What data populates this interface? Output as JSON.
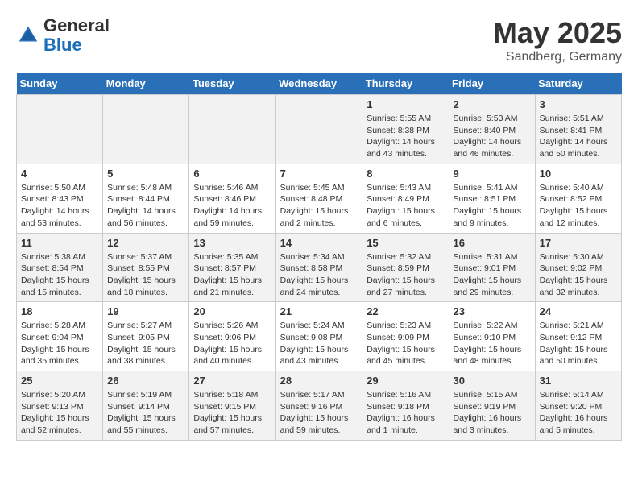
{
  "header": {
    "logo_general": "General",
    "logo_blue": "Blue",
    "month": "May 2025",
    "location": "Sandberg, Germany"
  },
  "days_of_week": [
    "Sunday",
    "Monday",
    "Tuesday",
    "Wednesday",
    "Thursday",
    "Friday",
    "Saturday"
  ],
  "weeks": [
    [
      {
        "day": "",
        "info": ""
      },
      {
        "day": "",
        "info": ""
      },
      {
        "day": "",
        "info": ""
      },
      {
        "day": "",
        "info": ""
      },
      {
        "day": "1",
        "info": "Sunrise: 5:55 AM\nSunset: 8:38 PM\nDaylight: 14 hours\nand 43 minutes."
      },
      {
        "day": "2",
        "info": "Sunrise: 5:53 AM\nSunset: 8:40 PM\nDaylight: 14 hours\nand 46 minutes."
      },
      {
        "day": "3",
        "info": "Sunrise: 5:51 AM\nSunset: 8:41 PM\nDaylight: 14 hours\nand 50 minutes."
      }
    ],
    [
      {
        "day": "4",
        "info": "Sunrise: 5:50 AM\nSunset: 8:43 PM\nDaylight: 14 hours\nand 53 minutes."
      },
      {
        "day": "5",
        "info": "Sunrise: 5:48 AM\nSunset: 8:44 PM\nDaylight: 14 hours\nand 56 minutes."
      },
      {
        "day": "6",
        "info": "Sunrise: 5:46 AM\nSunset: 8:46 PM\nDaylight: 14 hours\nand 59 minutes."
      },
      {
        "day": "7",
        "info": "Sunrise: 5:45 AM\nSunset: 8:48 PM\nDaylight: 15 hours\nand 2 minutes."
      },
      {
        "day": "8",
        "info": "Sunrise: 5:43 AM\nSunset: 8:49 PM\nDaylight: 15 hours\nand 6 minutes."
      },
      {
        "day": "9",
        "info": "Sunrise: 5:41 AM\nSunset: 8:51 PM\nDaylight: 15 hours\nand 9 minutes."
      },
      {
        "day": "10",
        "info": "Sunrise: 5:40 AM\nSunset: 8:52 PM\nDaylight: 15 hours\nand 12 minutes."
      }
    ],
    [
      {
        "day": "11",
        "info": "Sunrise: 5:38 AM\nSunset: 8:54 PM\nDaylight: 15 hours\nand 15 minutes."
      },
      {
        "day": "12",
        "info": "Sunrise: 5:37 AM\nSunset: 8:55 PM\nDaylight: 15 hours\nand 18 minutes."
      },
      {
        "day": "13",
        "info": "Sunrise: 5:35 AM\nSunset: 8:57 PM\nDaylight: 15 hours\nand 21 minutes."
      },
      {
        "day": "14",
        "info": "Sunrise: 5:34 AM\nSunset: 8:58 PM\nDaylight: 15 hours\nand 24 minutes."
      },
      {
        "day": "15",
        "info": "Sunrise: 5:32 AM\nSunset: 8:59 PM\nDaylight: 15 hours\nand 27 minutes."
      },
      {
        "day": "16",
        "info": "Sunrise: 5:31 AM\nSunset: 9:01 PM\nDaylight: 15 hours\nand 29 minutes."
      },
      {
        "day": "17",
        "info": "Sunrise: 5:30 AM\nSunset: 9:02 PM\nDaylight: 15 hours\nand 32 minutes."
      }
    ],
    [
      {
        "day": "18",
        "info": "Sunrise: 5:28 AM\nSunset: 9:04 PM\nDaylight: 15 hours\nand 35 minutes."
      },
      {
        "day": "19",
        "info": "Sunrise: 5:27 AM\nSunset: 9:05 PM\nDaylight: 15 hours\nand 38 minutes."
      },
      {
        "day": "20",
        "info": "Sunrise: 5:26 AM\nSunset: 9:06 PM\nDaylight: 15 hours\nand 40 minutes."
      },
      {
        "day": "21",
        "info": "Sunrise: 5:24 AM\nSunset: 9:08 PM\nDaylight: 15 hours\nand 43 minutes."
      },
      {
        "day": "22",
        "info": "Sunrise: 5:23 AM\nSunset: 9:09 PM\nDaylight: 15 hours\nand 45 minutes."
      },
      {
        "day": "23",
        "info": "Sunrise: 5:22 AM\nSunset: 9:10 PM\nDaylight: 15 hours\nand 48 minutes."
      },
      {
        "day": "24",
        "info": "Sunrise: 5:21 AM\nSunset: 9:12 PM\nDaylight: 15 hours\nand 50 minutes."
      }
    ],
    [
      {
        "day": "25",
        "info": "Sunrise: 5:20 AM\nSunset: 9:13 PM\nDaylight: 15 hours\nand 52 minutes."
      },
      {
        "day": "26",
        "info": "Sunrise: 5:19 AM\nSunset: 9:14 PM\nDaylight: 15 hours\nand 55 minutes."
      },
      {
        "day": "27",
        "info": "Sunrise: 5:18 AM\nSunset: 9:15 PM\nDaylight: 15 hours\nand 57 minutes."
      },
      {
        "day": "28",
        "info": "Sunrise: 5:17 AM\nSunset: 9:16 PM\nDaylight: 15 hours\nand 59 minutes."
      },
      {
        "day": "29",
        "info": "Sunrise: 5:16 AM\nSunset: 9:18 PM\nDaylight: 16 hours\nand 1 minute."
      },
      {
        "day": "30",
        "info": "Sunrise: 5:15 AM\nSunset: 9:19 PM\nDaylight: 16 hours\nand 3 minutes."
      },
      {
        "day": "31",
        "info": "Sunrise: 5:14 AM\nSunset: 9:20 PM\nDaylight: 16 hours\nand 5 minutes."
      }
    ]
  ]
}
